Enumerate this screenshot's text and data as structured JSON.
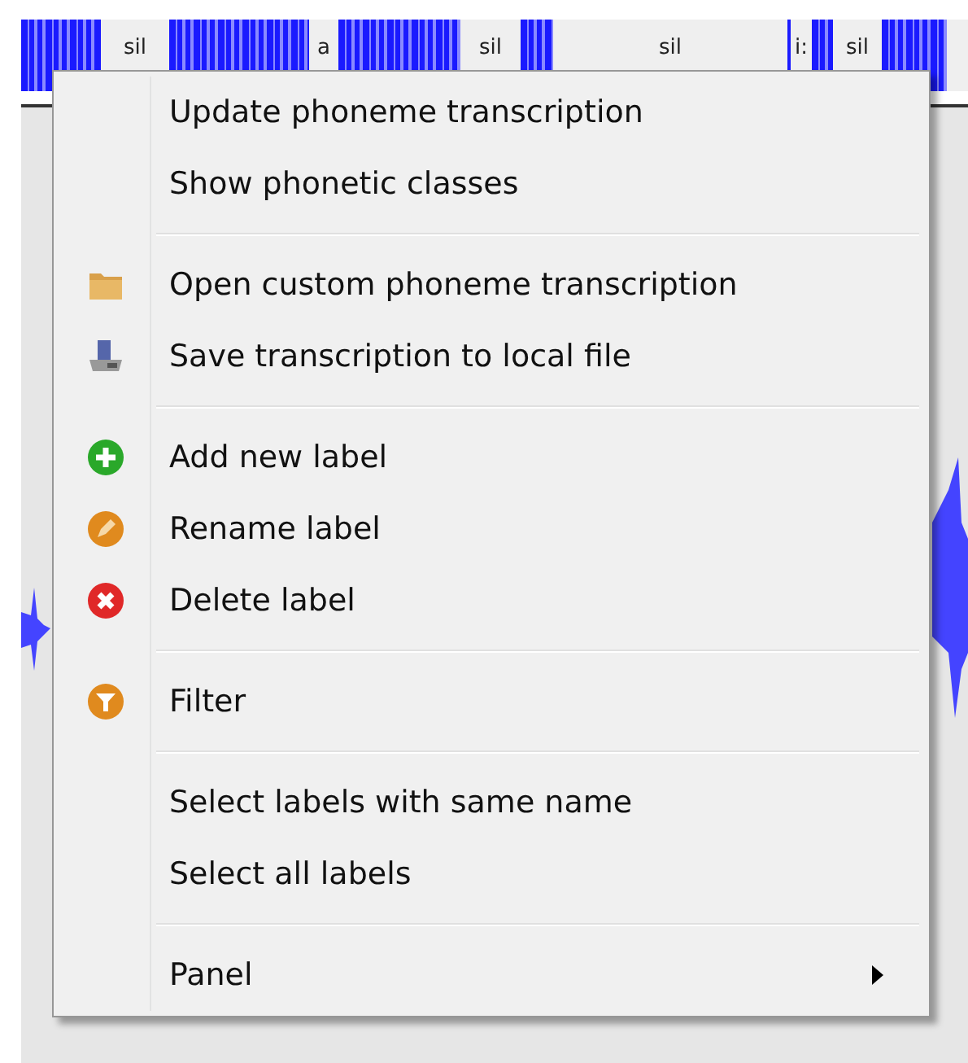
{
  "tier": {
    "labels": [
      "sil",
      "a",
      "sil",
      "sil",
      "i:",
      "sil"
    ]
  },
  "context_menu": {
    "sections": [
      {
        "items": [
          {
            "label": "Update phoneme transcription",
            "kind": "plain"
          },
          {
            "label": "Show phonetic classes",
            "kind": "plain"
          }
        ]
      },
      {
        "items": [
          {
            "label": "Open custom phoneme transcription",
            "kind": "folder"
          },
          {
            "label": "Save transcription to local file",
            "kind": "disk"
          }
        ]
      },
      {
        "items": [
          {
            "label": "Add new label",
            "kind": "add"
          },
          {
            "label": "Rename label",
            "kind": "rename"
          },
          {
            "label": "Delete label",
            "kind": "delete"
          }
        ]
      },
      {
        "items": [
          {
            "label": "Filter",
            "kind": "filter"
          }
        ]
      },
      {
        "items": [
          {
            "label": "Select labels with same name",
            "kind": "plain"
          },
          {
            "label": "Select all labels",
            "kind": "plain"
          }
        ]
      },
      {
        "items": [
          {
            "label": "Panel",
            "kind": "plain",
            "submenu": true
          }
        ]
      }
    ]
  }
}
